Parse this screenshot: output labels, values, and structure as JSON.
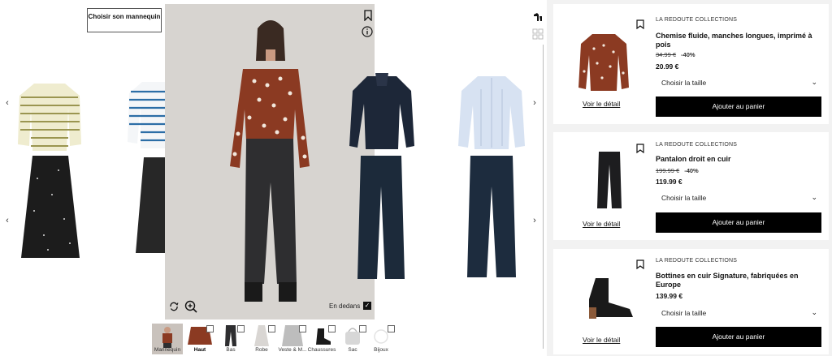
{
  "outfit": {
    "choose_mannequin": "Choisir son mannequin",
    "inside_label": "En dedans",
    "thumbnails": [
      {
        "label": "Mannequin"
      },
      {
        "label": "Haut"
      },
      {
        "label": "Bas"
      },
      {
        "label": "Robe"
      },
      {
        "label": "Veste & M..."
      },
      {
        "label": "Chaussures"
      },
      {
        "label": "Sac"
      },
      {
        "label": "Bijoux"
      }
    ]
  },
  "products": [
    {
      "brand": "LA REDOUTE COLLECTIONS",
      "name": "Chemise fluide, manches longues, imprimé à pois",
      "old_price": "34.99 €",
      "discount": "-40%",
      "price": "20.99 €",
      "size_placeholder": "Choisir la taille",
      "cart_label": "Ajouter au panier",
      "detail_label": "Voir le détail"
    },
    {
      "brand": "LA REDOUTE COLLECTIONS",
      "name": "Pantalon droit en cuir",
      "old_price": "199.99 €",
      "discount": "-40%",
      "price": "119.99 €",
      "size_placeholder": "Choisir la taille",
      "cart_label": "Ajouter au panier",
      "detail_label": "Voir le détail"
    },
    {
      "brand": "LA REDOUTE COLLECTIONS",
      "name": "Bottines en cuir Signature, fabriquées en Europe",
      "price": "139.99 €",
      "size_placeholder": "Choisir la taille",
      "cart_label": "Ajouter au panier",
      "detail_label": "Voir le détail"
    }
  ],
  "colors": {
    "accent": "#000000",
    "stage_bg": "#d7d4d0",
    "panel_bg": "#f2f2f2",
    "shirt": "#8b3a22"
  }
}
